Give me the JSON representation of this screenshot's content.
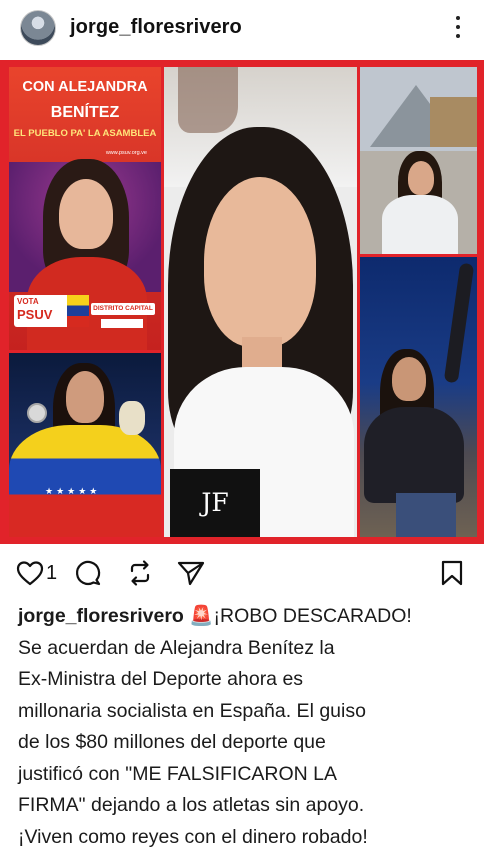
{
  "post": {
    "username": "jorge_floresrivero",
    "avatar_icon": "profile-avatar",
    "more_icon": "more-vertical-icon"
  },
  "images": {
    "campaign": {
      "line1": "CON ALEJANDRA",
      "line2": "BENÍTEZ",
      "line3": "EL PUEBLO PA' LA ASAMBLEA",
      "url": "www.psuv.org.ve",
      "vote_top": "VOTA",
      "vote_party": "PSUV",
      "district": "DISTRITO CAPITAL"
    },
    "center": {
      "badge": "JF"
    }
  },
  "actions": {
    "like_count": "1",
    "icons": [
      "heart-icon",
      "comment-icon",
      "repost-icon",
      "share-icon",
      "bookmark-icon"
    ]
  },
  "caption": {
    "username": "jorge_floresrivero",
    "emoji": "🚨",
    "line1_rest": "¡ROBO DESCARADO!",
    "line2": "Se acuerdan de Alejandra Benítez la",
    "line3": "Ex-Ministra del Deporte ahora es",
    "line4": "millonaria socialista en España. El guiso",
    "line5": "de los $80 millones del deporte que",
    "line6": "justificó con \"ME FALSIFICARON LA",
    "line7": "FIRMA\" dejando a los atletas sin apoyo.",
    "line8": "¡Viven como reyes con el dinero robado!"
  },
  "colors": {
    "frame_red": "#e1232a",
    "text": "#1b1b1b"
  }
}
